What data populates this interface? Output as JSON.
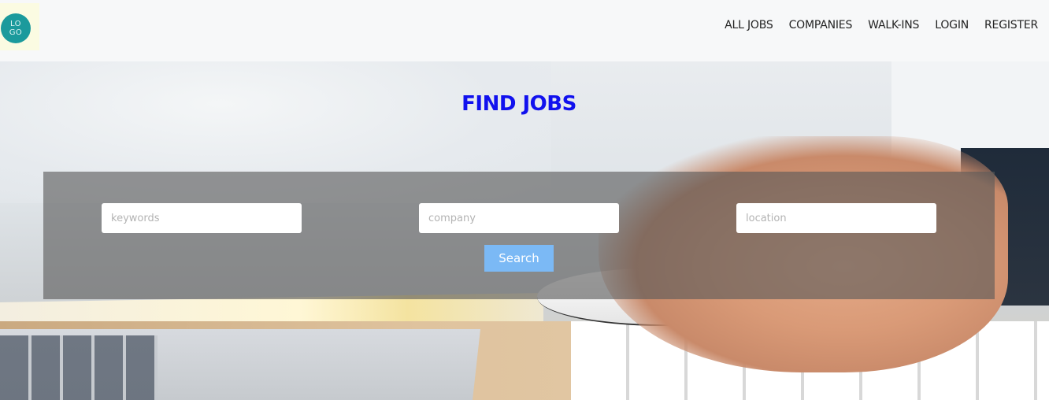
{
  "logo": {
    "line1": "LO",
    "line2": "GO"
  },
  "nav": {
    "items": [
      {
        "label": "ALL JOBS"
      },
      {
        "label": "COMPANIES"
      },
      {
        "label": "WALK-INS"
      },
      {
        "label": "LOGIN"
      },
      {
        "label": "REGISTER"
      }
    ]
  },
  "hero": {
    "title": "FIND JOBS"
  },
  "search": {
    "keywords": {
      "value": "",
      "placeholder": "keywords"
    },
    "company": {
      "value": "",
      "placeholder": "company"
    },
    "location": {
      "value": "",
      "placeholder": "location"
    },
    "button_label": "Search"
  },
  "colors": {
    "title": "#1111ee",
    "button": "#7bb9f5",
    "logo": "#1b9a9c"
  }
}
